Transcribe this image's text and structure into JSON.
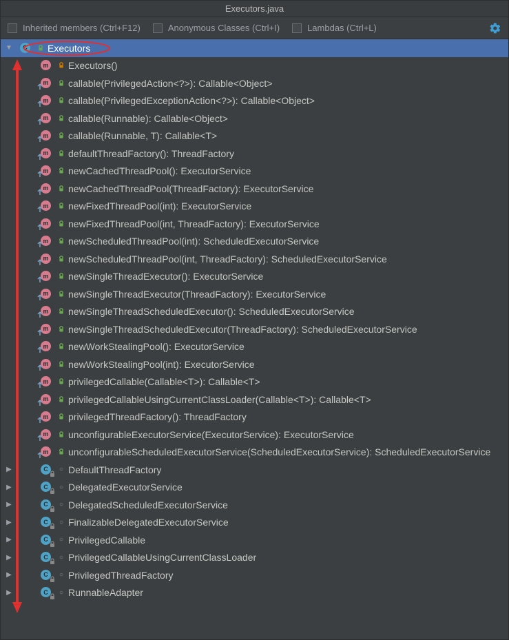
{
  "title": "Executors.java",
  "toolbar": {
    "inherited": "Inherited members (Ctrl+F12)",
    "anonymous": "Anonymous Classes (Ctrl+I)",
    "lambdas": "Lambdas (Ctrl+L)"
  },
  "root": {
    "label": "Executors"
  },
  "members": [
    {
      "kind": "method",
      "vis": "private",
      "overlay": "none",
      "label": "Executors()"
    },
    {
      "kind": "method",
      "vis": "public",
      "overlay": "up",
      "label": "callable(PrivilegedAction<?>): Callable<Object>"
    },
    {
      "kind": "method",
      "vis": "public",
      "overlay": "up",
      "label": "callable(PrivilegedExceptionAction<?>): Callable<Object>"
    },
    {
      "kind": "method",
      "vis": "public",
      "overlay": "up",
      "label": "callable(Runnable): Callable<Object>"
    },
    {
      "kind": "method",
      "vis": "public",
      "overlay": "up",
      "label": "callable(Runnable, T): Callable<T>"
    },
    {
      "kind": "method",
      "vis": "public",
      "overlay": "up",
      "label": "defaultThreadFactory(): ThreadFactory"
    },
    {
      "kind": "method",
      "vis": "public",
      "overlay": "up",
      "label": "newCachedThreadPool(): ExecutorService"
    },
    {
      "kind": "method",
      "vis": "public",
      "overlay": "up",
      "label": "newCachedThreadPool(ThreadFactory): ExecutorService"
    },
    {
      "kind": "method",
      "vis": "public",
      "overlay": "up",
      "label": "newFixedThreadPool(int): ExecutorService"
    },
    {
      "kind": "method",
      "vis": "public",
      "overlay": "up",
      "label": "newFixedThreadPool(int, ThreadFactory): ExecutorService"
    },
    {
      "kind": "method",
      "vis": "public",
      "overlay": "up",
      "label": "newScheduledThreadPool(int): ScheduledExecutorService"
    },
    {
      "kind": "method",
      "vis": "public",
      "overlay": "up",
      "label": "newScheduledThreadPool(int, ThreadFactory): ScheduledExecutorService"
    },
    {
      "kind": "method",
      "vis": "public",
      "overlay": "up",
      "label": "newSingleThreadExecutor(): ExecutorService"
    },
    {
      "kind": "method",
      "vis": "public",
      "overlay": "up",
      "label": "newSingleThreadExecutor(ThreadFactory): ExecutorService"
    },
    {
      "kind": "method",
      "vis": "public",
      "overlay": "up",
      "label": "newSingleThreadScheduledExecutor(): ScheduledExecutorService"
    },
    {
      "kind": "method",
      "vis": "public",
      "overlay": "up",
      "label": "newSingleThreadScheduledExecutor(ThreadFactory): ScheduledExecutorService"
    },
    {
      "kind": "method",
      "vis": "public",
      "overlay": "up",
      "label": "newWorkStealingPool(): ExecutorService"
    },
    {
      "kind": "method",
      "vis": "public",
      "overlay": "up",
      "label": "newWorkStealingPool(int): ExecutorService"
    },
    {
      "kind": "method",
      "vis": "public",
      "overlay": "up",
      "label": "privilegedCallable(Callable<T>): Callable<T>"
    },
    {
      "kind": "method",
      "vis": "public",
      "overlay": "up",
      "label": "privilegedCallableUsingCurrentClassLoader(Callable<T>): Callable<T>"
    },
    {
      "kind": "method",
      "vis": "public",
      "overlay": "up",
      "label": "privilegedThreadFactory(): ThreadFactory"
    },
    {
      "kind": "method",
      "vis": "public",
      "overlay": "up",
      "label": "unconfigurableExecutorService(ExecutorService): ExecutorService"
    },
    {
      "kind": "method",
      "vis": "public",
      "overlay": "up",
      "label": "unconfigurableScheduledExecutorService(ScheduledExecutorService): ScheduledExecutorService"
    }
  ],
  "inner_classes": [
    {
      "label": "DefaultThreadFactory"
    },
    {
      "label": "DelegatedExecutorService"
    },
    {
      "label": "DelegatedScheduledExecutorService"
    },
    {
      "label": "FinalizableDelegatedExecutorService"
    },
    {
      "label": "PrivilegedCallable"
    },
    {
      "label": "PrivilegedCallableUsingCurrentClassLoader"
    },
    {
      "label": "PrivilegedThreadFactory"
    },
    {
      "label": "RunnableAdapter"
    }
  ]
}
